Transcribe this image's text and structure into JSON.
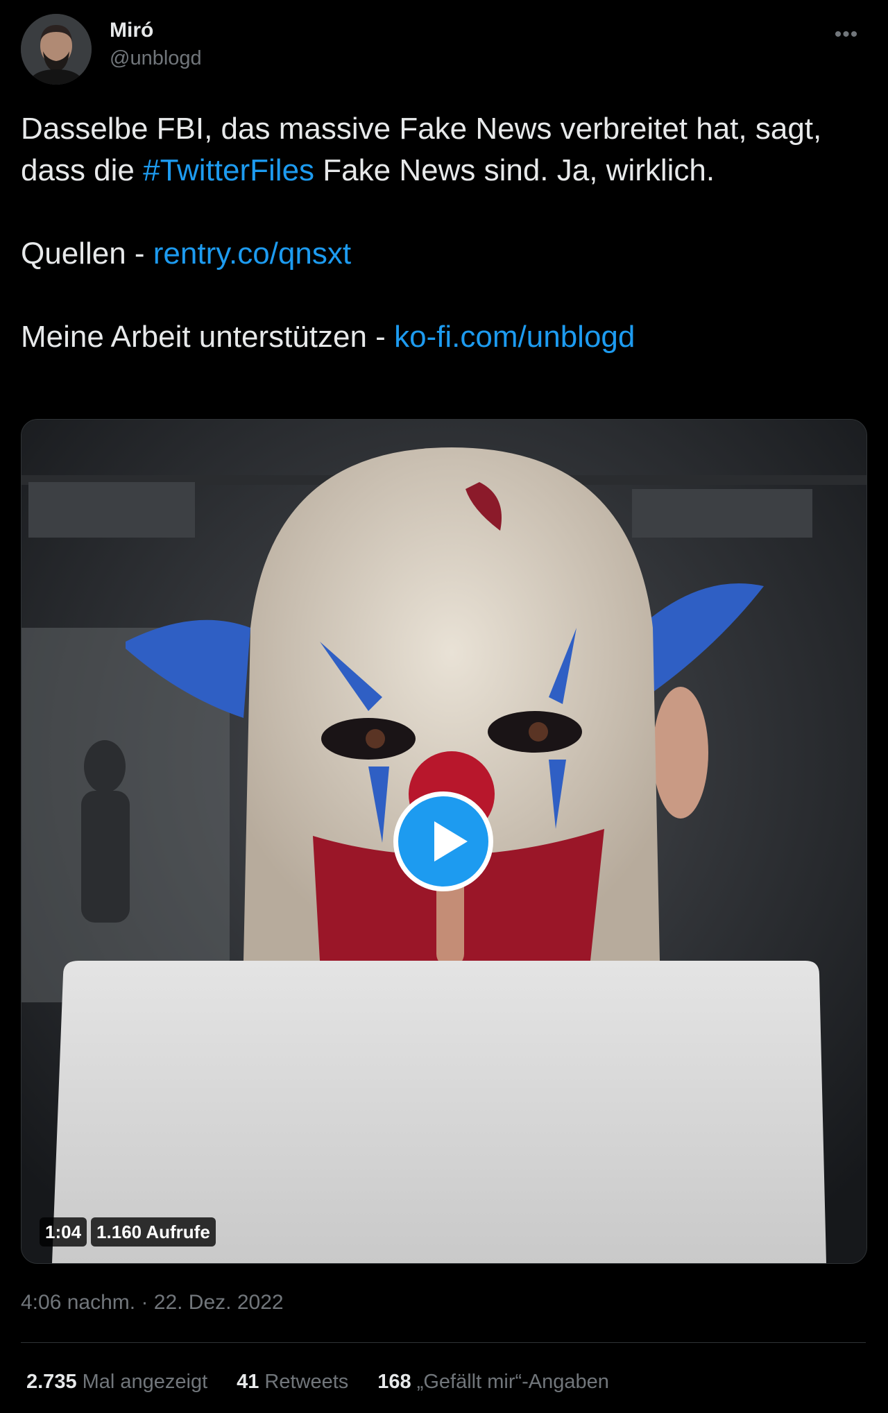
{
  "author": {
    "display_name": "Miró",
    "handle": "@unblogd",
    "avatar_icon": "person-avatar"
  },
  "more_icon": "more-horizontal-icon",
  "more_glyph": "•••",
  "tweet": {
    "line1_pre": "Dasselbe FBI, das massive Fake News verbreitet hat, sagt, dass die ",
    "hashtag": "#TwitterFiles",
    "line1_post": " Fake News sind. Ja, wirklich.",
    "sources_label": "Quellen - ",
    "sources_link": "rentry.co/qnsxt",
    "support_label": "Meine Arbeit unterstützen - ",
    "support_link": "ko-fi.com/unblogd"
  },
  "video": {
    "play_icon": "play-icon",
    "duration": "1:04",
    "views": "1.160 Aufrufe"
  },
  "timestamp": "4:06 nachm. · 22. Dez. 2022",
  "stats": {
    "views_count": "2.735",
    "views_label": "Mal angezeigt",
    "retweets_count": "41",
    "retweets_label": "Retweets",
    "likes_count": "168",
    "likes_label": "„Gefällt mir“-Angaben"
  },
  "colors": {
    "background": "#000000",
    "text": "#e7e9ea",
    "secondary": "#71767b",
    "accent": "#1d9bf0",
    "divider": "#2f3336"
  }
}
